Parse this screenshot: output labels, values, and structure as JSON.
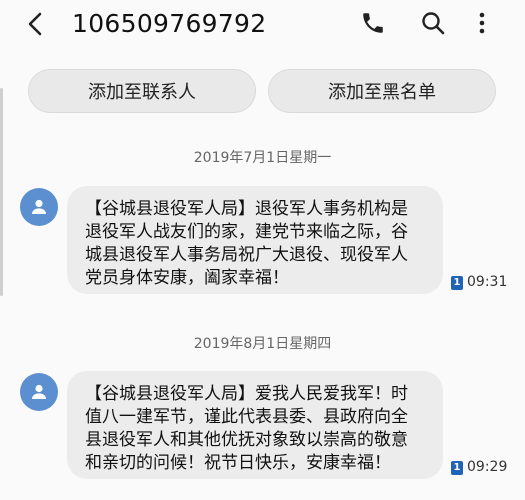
{
  "header": {
    "title": "106509769792",
    "icons": [
      "back-icon",
      "phone-icon",
      "search-icon",
      "more-vertical-icon"
    ]
  },
  "actions": {
    "add_contact": "添加至联系人",
    "add_blacklist": "添加至黑名单"
  },
  "messages": [
    {
      "date": "2019年7月1日星期一",
      "text": "【谷城县退役军人局】退役军人事务机构是\n退役军人战友们的家，建党节来临之际，谷\n城县退役军人事务局祝广大退役、现役军人\n党员身体安康，阖家幸福！",
      "sim": "1",
      "time": "09:31"
    },
    {
      "date": "2019年8月1日星期四",
      "text": "【谷城县退役军人局】爱我人民爱我军！时\n值八一建军节，谨此代表县委、县政府向全\n县退役军人和其他优抚对象致以崇高的敬意\n和亲切的问候！祝节日快乐，安康幸福！",
      "sim": "1",
      "time": "09:29"
    }
  ],
  "colors": {
    "avatar": "#5b8fd0",
    "bubble": "#ececec",
    "sim_badge": "#1f64b6"
  }
}
